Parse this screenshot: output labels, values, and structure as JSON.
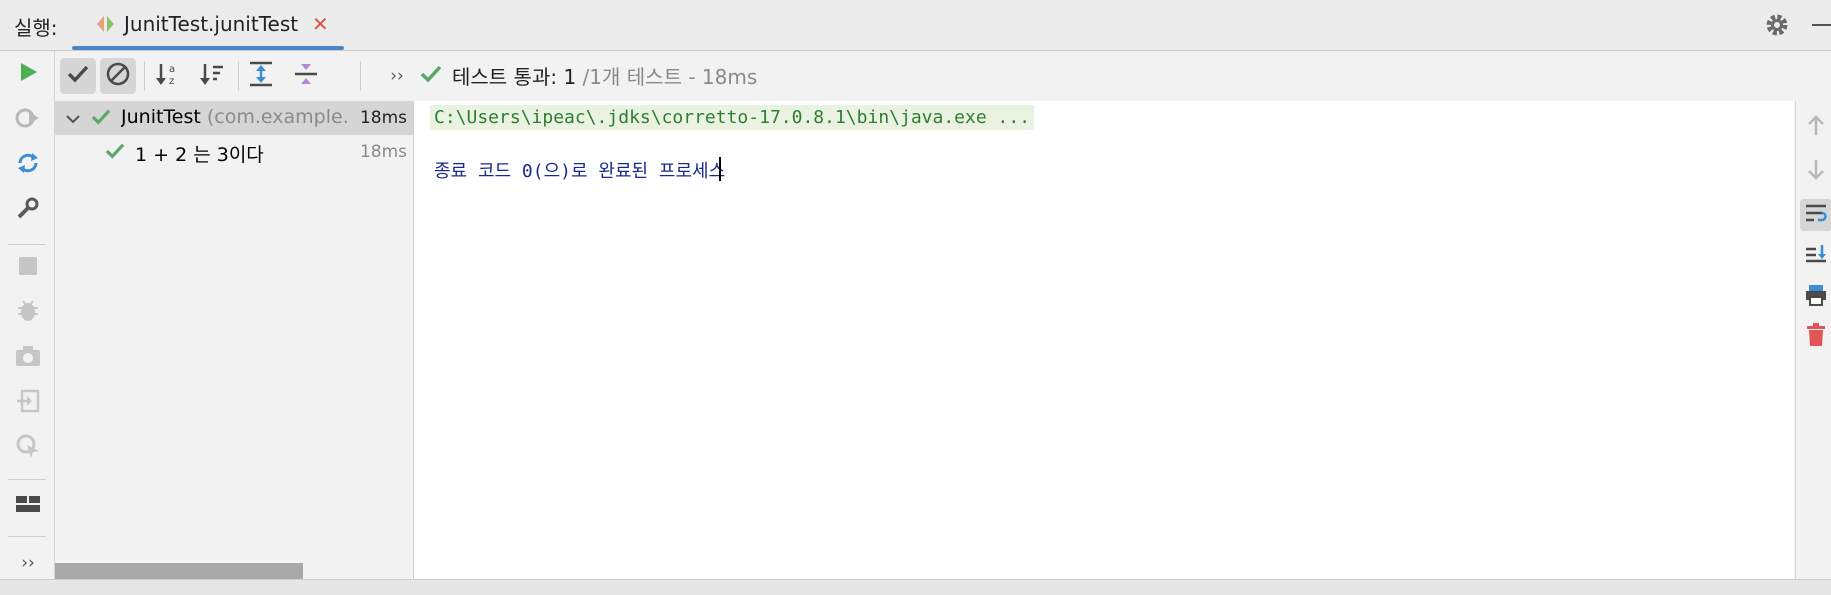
{
  "tabbar": {
    "run_label": "실행:",
    "tab_title": "JunitTest.junitTest",
    "tab_close": "✕"
  },
  "toolbar": {
    "more": "››",
    "status_passed": "테스트 통과: 1",
    "status_detail": "/1개 테스트 - 18ms"
  },
  "tree": {
    "root": {
      "name": "JunitTest",
      "package": "(com.example.s",
      "time": "18ms"
    },
    "child": {
      "name": "1 + 2 는 3이다",
      "time": "18ms"
    }
  },
  "console": {
    "command": "C:\\Users\\ipeac\\.jdks\\corretto-17.0.8.1\\bin\\java.exe ...",
    "exit_message": "종료 코드 0(으)로 완료된 프로세스"
  },
  "left_toolbar": {
    "more": "››"
  },
  "colors": {
    "accent": "#4a86c8",
    "pass_green": "#59a869",
    "console_cmd_bg": "#eaf3e1",
    "console_exit_text": "#1a2a8a"
  }
}
